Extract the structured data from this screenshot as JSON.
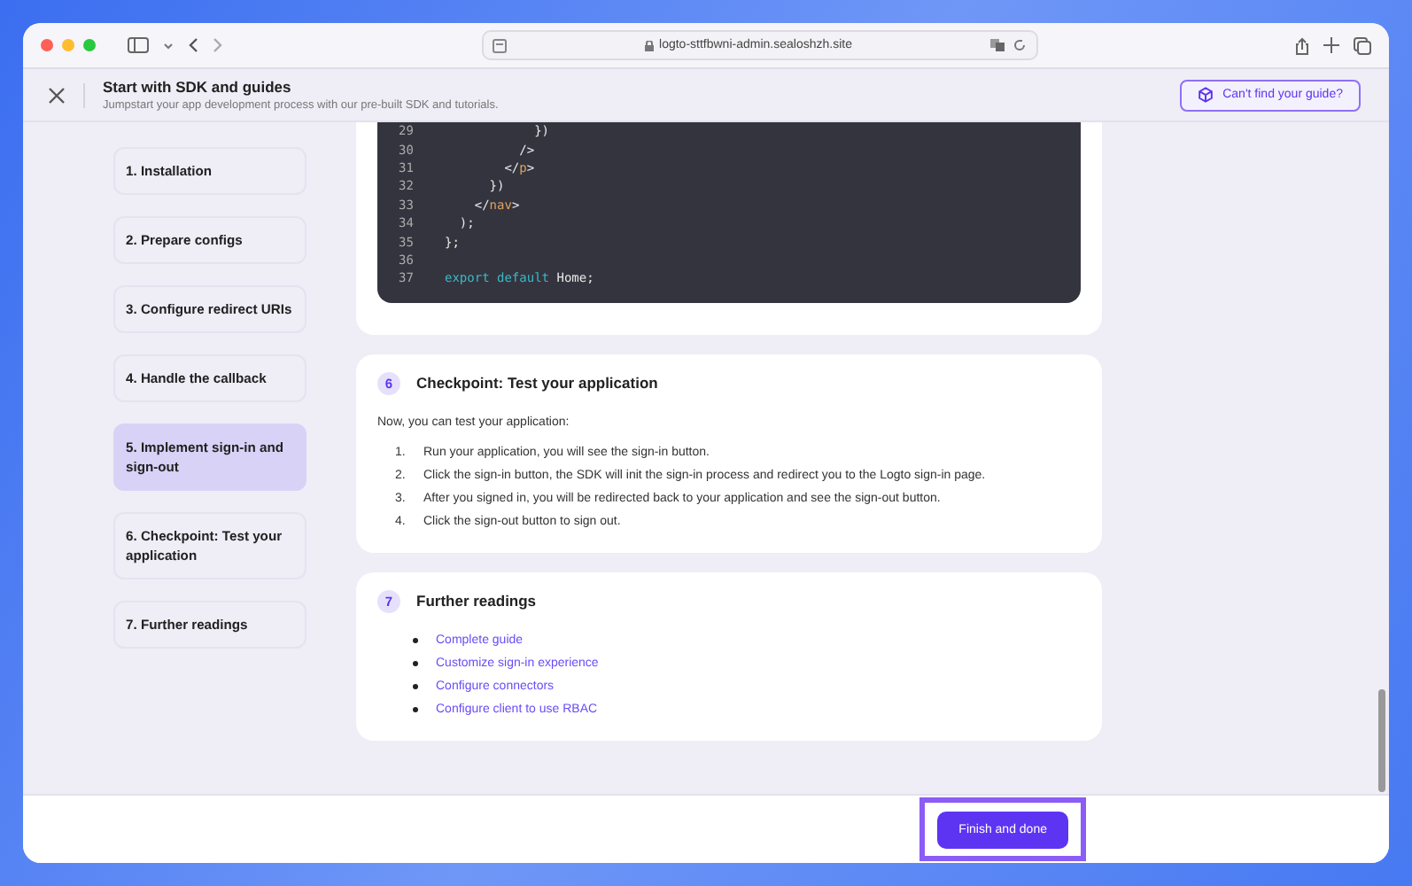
{
  "browser": {
    "url": "logto-sttfbwni-admin.sealoshzh.site"
  },
  "header": {
    "title": "Start with SDK and guides",
    "subtitle": "Jumpstart your app development process with our pre-built SDK and tutorials.",
    "help_button": "Can't find your guide?"
  },
  "steps": [
    {
      "label": "1. Installation",
      "selected": false
    },
    {
      "label": "2. Prepare configs",
      "selected": false
    },
    {
      "label": "3. Configure redirect URIs",
      "selected": false
    },
    {
      "label": "4. Handle the callback",
      "selected": false
    },
    {
      "label": "5. Implement sign-in and sign-out",
      "selected": true
    },
    {
      "label": "6. Checkpoint: Test your application",
      "selected": false
    },
    {
      "label": "7. Further readings",
      "selected": false
    }
  ],
  "code": [
    {
      "number": "29",
      "tokens": [
        {
          "text": "            })",
          "kind": "plain"
        }
      ]
    },
    {
      "number": "30",
      "tokens": [
        {
          "text": "          />",
          "kind": "plain"
        }
      ]
    },
    {
      "number": "31",
      "tokens": [
        {
          "text": "        </",
          "kind": "plain"
        },
        {
          "text": "p",
          "kind": "tag"
        },
        {
          "text": ">",
          "kind": "plain"
        }
      ]
    },
    {
      "number": "32",
      "tokens": [
        {
          "text": "      })",
          "kind": "plain"
        }
      ]
    },
    {
      "number": "33",
      "tokens": [
        {
          "text": "    </",
          "kind": "plain"
        },
        {
          "text": "nav",
          "kind": "tag"
        },
        {
          "text": ">",
          "kind": "plain"
        }
      ]
    },
    {
      "number": "34",
      "tokens": [
        {
          "text": "  );",
          "kind": "plain"
        }
      ]
    },
    {
      "number": "35",
      "tokens": [
        {
          "text": "};",
          "kind": "plain"
        }
      ]
    },
    {
      "number": "36"
    },
    {
      "number": "37",
      "tokens": [
        {
          "text": "export default",
          "kind": "keyword"
        },
        {
          "text": " Home;",
          "kind": "plain"
        }
      ]
    }
  ],
  "sections": [
    {
      "number": "6",
      "title": "Checkpoint: Test your application",
      "kind": "ordered",
      "intro": "Now, you can test your application:",
      "items": [
        {
          "marker": "1.",
          "text": "Run your application, you will see the sign-in button."
        },
        {
          "marker": "2.",
          "text": "Click the sign-in button, the SDK will init the sign-in process and redirect you to the Logto sign-in page."
        },
        {
          "marker": "3.",
          "text": "After you signed in, you will be redirected back to your application and see the sign-out button."
        },
        {
          "marker": "4.",
          "text": "Click the sign-out button to sign out."
        }
      ]
    },
    {
      "number": "7",
      "title": "Further readings",
      "kind": "links",
      "items": [
        "Complete guide",
        "Customize sign-in experience",
        "Configure connectors",
        "Configure client to use RBAC"
      ]
    }
  ],
  "footer": {
    "button": "Finish and done",
    "highlighted": true
  }
}
